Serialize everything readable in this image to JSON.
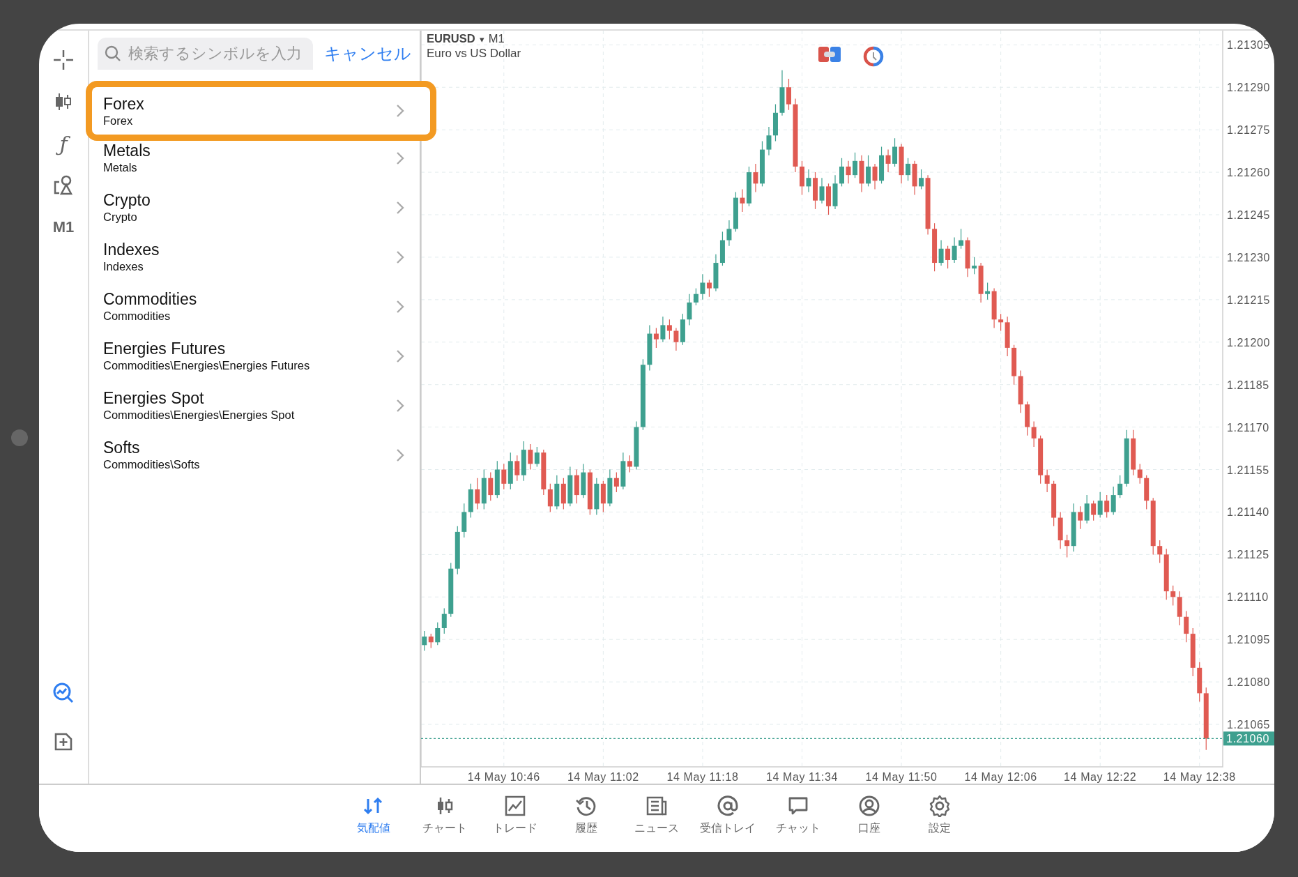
{
  "toolbar": {
    "function_glyph": "ƒ",
    "timeframe": "M1"
  },
  "search": {
    "placeholder": "検索するシンボルを入力",
    "cancel": "キャンセル"
  },
  "groups": [
    {
      "title": "Forex",
      "subtitle": "Forex",
      "selected": true
    },
    {
      "title": "Metals",
      "subtitle": "Metals",
      "selected": false
    },
    {
      "title": "Crypto",
      "subtitle": "Crypto",
      "selected": false
    },
    {
      "title": "Indexes",
      "subtitle": "Indexes",
      "selected": false
    },
    {
      "title": "Commodities",
      "subtitle": "Commodities",
      "selected": false
    },
    {
      "title": "Energies Futures",
      "subtitle": "Commodities\\Energies\\Energies Futures",
      "selected": false
    },
    {
      "title": "Energies Spot",
      "subtitle": "Commodities\\Energies\\Energies Spot",
      "selected": false
    },
    {
      "title": "Softs",
      "subtitle": "Commodities\\Softs",
      "selected": false
    }
  ],
  "chart": {
    "symbol": "EURUSD",
    "dropdown": "▾",
    "timeframe": "M1",
    "description": "Euro vs US Dollar",
    "chart_data": {
      "type": "candlestick",
      "ylim": [
        1.2105,
        1.2131
      ],
      "grid": true,
      "ref_lines": [
        {
          "axis": "y",
          "value": 1.2106,
          "label": "1.21060"
        }
      ],
      "categories": [
        null,
        null,
        null,
        null,
        null,
        null,
        null,
        null,
        null,
        null,
        null,
        null,
        "14 May 10:46",
        null,
        null,
        null,
        null,
        null,
        null,
        null,
        null,
        null,
        null,
        null,
        null,
        null,
        null,
        "14 May 11:02",
        null,
        null,
        null,
        null,
        null,
        null,
        null,
        null,
        null,
        null,
        null,
        null,
        null,
        null,
        "14 May 11:18",
        null,
        null,
        null,
        null,
        null,
        null,
        null,
        null,
        null,
        null,
        null,
        null,
        null,
        null,
        "14 May 11:34",
        null,
        null,
        null,
        null,
        null,
        null,
        null,
        null,
        null,
        null,
        null,
        null,
        null,
        null,
        "14 May 11:50",
        null,
        null,
        null,
        null,
        null,
        null,
        null,
        null,
        null,
        null,
        null,
        null,
        null,
        null,
        "14 May 12:06",
        null,
        null,
        null,
        null,
        null,
        null,
        null,
        null,
        null,
        null,
        null,
        null,
        null,
        null,
        "14 May 12:22",
        null,
        null,
        null,
        null,
        null,
        null,
        null,
        null,
        null,
        null,
        null,
        null,
        null,
        null,
        "14 May 12:38",
        null
      ],
      "ohlc": [
        [
          1.21093,
          1.21098,
          1.21091,
          1.21096
        ],
        [
          1.21096,
          1.21097,
          1.21092,
          1.21094
        ],
        [
          1.21094,
          1.21101,
          1.21093,
          1.21099
        ],
        [
          1.21099,
          1.21106,
          1.21097,
          1.21104
        ],
        [
          1.21104,
          1.21122,
          1.21103,
          1.2112
        ],
        [
          1.2112,
          1.21135,
          1.21118,
          1.21133
        ],
        [
          1.21133,
          1.21143,
          1.21131,
          1.2114
        ],
        [
          1.2114,
          1.2115,
          1.21138,
          1.21148
        ],
        [
          1.21148,
          1.21152,
          1.21141,
          1.21143
        ],
        [
          1.21143,
          1.21155,
          1.21141,
          1.21152
        ],
        [
          1.21152,
          1.21154,
          1.21144,
          1.21146
        ],
        [
          1.21146,
          1.21158,
          1.21145,
          1.21155
        ],
        [
          1.21155,
          1.21157,
          1.21148,
          1.2115
        ],
        [
          1.2115,
          1.21161,
          1.21148,
          1.21158
        ],
        [
          1.21158,
          1.2116,
          1.21151,
          1.21153
        ],
        [
          1.21153,
          1.21165,
          1.21151,
          1.21162
        ],
        [
          1.21162,
          1.21164,
          1.21155,
          1.21157
        ],
        [
          1.21157,
          1.21163,
          1.21156,
          1.21161
        ],
        [
          1.21161,
          1.21162,
          1.21146,
          1.21148
        ],
        [
          1.21148,
          1.2115,
          1.2114,
          1.21142
        ],
        [
          1.21142,
          1.21153,
          1.21141,
          1.2115
        ],
        [
          1.2115,
          1.21152,
          1.21141,
          1.21143
        ],
        [
          1.21143,
          1.21156,
          1.21142,
          1.21153
        ],
        [
          1.21153,
          1.21155,
          1.21143,
          1.21146
        ],
        [
          1.21146,
          1.21157,
          1.21145,
          1.21154
        ],
        [
          1.21154,
          1.21155,
          1.21139,
          1.21141
        ],
        [
          1.21141,
          1.21152,
          1.21139,
          1.2115
        ],
        [
          1.2115,
          1.21151,
          1.2114,
          1.21143
        ],
        [
          1.21143,
          1.21155,
          1.21142,
          1.21152
        ],
        [
          1.21152,
          1.21154,
          1.21147,
          1.21149
        ],
        [
          1.21149,
          1.21161,
          1.21148,
          1.21158
        ],
        [
          1.21158,
          1.2116,
          1.21154,
          1.21156
        ],
        [
          1.21156,
          1.21172,
          1.21155,
          1.2117
        ],
        [
          1.2117,
          1.21194,
          1.21169,
          1.21192
        ],
        [
          1.21192,
          1.21206,
          1.2119,
          1.21203
        ],
        [
          1.21203,
          1.21205,
          1.21198,
          1.21201
        ],
        [
          1.21201,
          1.21209,
          1.212,
          1.21206
        ],
        [
          1.21206,
          1.21208,
          1.21201,
          1.21204
        ],
        [
          1.21204,
          1.21205,
          1.21197,
          1.212
        ],
        [
          1.212,
          1.2121,
          1.21199,
          1.21208
        ],
        [
          1.21208,
          1.21217,
          1.21206,
          1.21214
        ],
        [
          1.21214,
          1.21219,
          1.21213,
          1.21217
        ],
        [
          1.21217,
          1.21224,
          1.21215,
          1.21221
        ],
        [
          1.21221,
          1.21222,
          1.21216,
          1.21219
        ],
        [
          1.21219,
          1.21231,
          1.21218,
          1.21228
        ],
        [
          1.21228,
          1.21239,
          1.21227,
          1.21236
        ],
        [
          1.21236,
          1.21243,
          1.21234,
          1.2124
        ],
        [
          1.2124,
          1.21253,
          1.21239,
          1.21251
        ],
        [
          1.21251,
          1.21254,
          1.21246,
          1.21249
        ],
        [
          1.21249,
          1.21262,
          1.21248,
          1.2126
        ],
        [
          1.2126,
          1.21263,
          1.21253,
          1.21256
        ],
        [
          1.21256,
          1.21271,
          1.21255,
          1.21268
        ],
        [
          1.21268,
          1.21276,
          1.21266,
          1.21273
        ],
        [
          1.21273,
          1.21284,
          1.21271,
          1.21281
        ],
        [
          1.21281,
          1.21296,
          1.2128,
          1.2129
        ],
        [
          1.2129,
          1.21293,
          1.21282,
          1.21284
        ],
        [
          1.21284,
          1.21286,
          1.2126,
          1.21262
        ],
        [
          1.21262,
          1.21264,
          1.21252,
          1.21255
        ],
        [
          1.21255,
          1.21261,
          1.21253,
          1.21258
        ],
        [
          1.21258,
          1.2126,
          1.21247,
          1.2125
        ],
        [
          1.2125,
          1.21258,
          1.21249,
          1.21255
        ],
        [
          1.21255,
          1.21256,
          1.21245,
          1.21248
        ],
        [
          1.21248,
          1.21259,
          1.21247,
          1.21256
        ],
        [
          1.21256,
          1.21265,
          1.21255,
          1.21262
        ],
        [
          1.21262,
          1.21264,
          1.21256,
          1.21259
        ],
        [
          1.21259,
          1.21267,
          1.21258,
          1.21264
        ],
        [
          1.21264,
          1.21266,
          1.21253,
          1.21256
        ],
        [
          1.21256,
          1.21266,
          1.21255,
          1.21262
        ],
        [
          1.21262,
          1.21263,
          1.21254,
          1.21257
        ],
        [
          1.21257,
          1.21269,
          1.21256,
          1.21266
        ],
        [
          1.21266,
          1.21268,
          1.2126,
          1.21263
        ],
        [
          1.21263,
          1.21272,
          1.21262,
          1.21269
        ],
        [
          1.21269,
          1.2127,
          1.21256,
          1.21259
        ],
        [
          1.21259,
          1.21265,
          1.21257,
          1.21263
        ],
        [
          1.21263,
          1.21264,
          1.21252,
          1.21255
        ],
        [
          1.21255,
          1.21261,
          1.21254,
          1.21258
        ],
        [
          1.21258,
          1.21259,
          1.21238,
          1.2124
        ],
        [
          1.2124,
          1.21242,
          1.21225,
          1.21228
        ],
        [
          1.21228,
          1.21236,
          1.21227,
          1.21233
        ],
        [
          1.21233,
          1.21234,
          1.21226,
          1.21229
        ],
        [
          1.21229,
          1.21237,
          1.21228,
          1.21234
        ],
        [
          1.21234,
          1.2124,
          1.21233,
          1.21236
        ],
        [
          1.21236,
          1.21237,
          1.21223,
          1.21226
        ],
        [
          1.21226,
          1.2123,
          1.21224,
          1.21227
        ],
        [
          1.21227,
          1.21228,
          1.21214,
          1.21217
        ],
        [
          1.21217,
          1.21221,
          1.21215,
          1.21218
        ],
        [
          1.21218,
          1.21219,
          1.21205,
          1.21208
        ],
        [
          1.21208,
          1.2121,
          1.21204,
          1.21207
        ],
        [
          1.21207,
          1.21209,
          1.21195,
          1.21198
        ],
        [
          1.21198,
          1.21199,
          1.21185,
          1.21188
        ],
        [
          1.21188,
          1.2119,
          1.21175,
          1.21178
        ],
        [
          1.21178,
          1.21179,
          1.21167,
          1.2117
        ],
        [
          1.2117,
          1.21172,
          1.21163,
          1.21166
        ],
        [
          1.21166,
          1.21167,
          1.2115,
          1.21153
        ],
        [
          1.21153,
          1.21155,
          1.21147,
          1.2115
        ],
        [
          1.2115,
          1.21151,
          1.21135,
          1.21138
        ],
        [
          1.21138,
          1.2114,
          1.21127,
          1.2113
        ],
        [
          1.2113,
          1.21132,
          1.21124,
          1.21128
        ],
        [
          1.21128,
          1.21143,
          1.21126,
          1.2114
        ],
        [
          1.2114,
          1.21142,
          1.21134,
          1.21137
        ],
        [
          1.21137,
          1.21146,
          1.21136,
          1.21143
        ],
        [
          1.21143,
          1.21144,
          1.21137,
          1.21139
        ],
        [
          1.21139,
          1.21147,
          1.21138,
          1.21144
        ],
        [
          1.21144,
          1.21146,
          1.21138,
          1.2114
        ],
        [
          1.2114,
          1.21149,
          1.21139,
          1.21146
        ],
        [
          1.21146,
          1.21153,
          1.21145,
          1.2115
        ],
        [
          1.2115,
          1.21169,
          1.21149,
          1.21166
        ],
        [
          1.21166,
          1.21169,
          1.21153,
          1.21155
        ],
        [
          1.21155,
          1.21157,
          1.2115,
          1.21152
        ],
        [
          1.21152,
          1.21153,
          1.21141,
          1.21144
        ],
        [
          1.21144,
          1.21145,
          1.21125,
          1.21128
        ],
        [
          1.21128,
          1.2113,
          1.21122,
          1.21125
        ],
        [
          1.21125,
          1.21127,
          1.21109,
          1.21112
        ],
        [
          1.21112,
          1.21114,
          1.21107,
          1.2111
        ],
        [
          1.2111,
          1.21112,
          1.211,
          1.21103
        ],
        [
          1.21103,
          1.21105,
          1.21094,
          1.21097
        ],
        [
          1.21097,
          1.21099,
          1.21082,
          1.21085
        ],
        [
          1.21085,
          1.21087,
          1.21073,
          1.21076
        ],
        [
          1.21076,
          1.21078,
          1.21056,
          1.2106
        ]
      ],
      "yticks": [
        {
          "value": 1.21305,
          "label": "1.21305"
        },
        {
          "value": 1.2129,
          "label": "1.21290"
        },
        {
          "value": 1.21275,
          "label": "1.21275"
        },
        {
          "value": 1.2126,
          "label": "1.21260"
        },
        {
          "value": 1.21245,
          "label": "1.21245"
        },
        {
          "value": 1.2123,
          "label": "1.21230"
        },
        {
          "value": 1.21215,
          "label": "1.21215"
        },
        {
          "value": 1.212,
          "label": "1.21200"
        },
        {
          "value": 1.21185,
          "label": "1.21185"
        },
        {
          "value": 1.2117,
          "label": "1.21170"
        },
        {
          "value": 1.21155,
          "label": "1.21155"
        },
        {
          "value": 1.2114,
          "label": "1.21140"
        },
        {
          "value": 1.21125,
          "label": "1.21125"
        },
        {
          "value": 1.2111,
          "label": "1.21110"
        },
        {
          "value": 1.21095,
          "label": "1.21095"
        },
        {
          "value": 1.2108,
          "label": "1.21080"
        },
        {
          "value": 1.21065,
          "label": "1.21065"
        }
      ]
    }
  },
  "tabs": [
    {
      "label": "気配値",
      "selected": true
    },
    {
      "label": "チャート",
      "selected": false
    },
    {
      "label": "トレード",
      "selected": false
    },
    {
      "label": "履歴",
      "selected": false
    },
    {
      "label": "ニュース",
      "selected": false
    },
    {
      "label": "受信トレイ",
      "selected": false
    },
    {
      "label": "チャット",
      "selected": false
    },
    {
      "label": "口座",
      "selected": false
    },
    {
      "label": "設定",
      "selected": false
    }
  ]
}
